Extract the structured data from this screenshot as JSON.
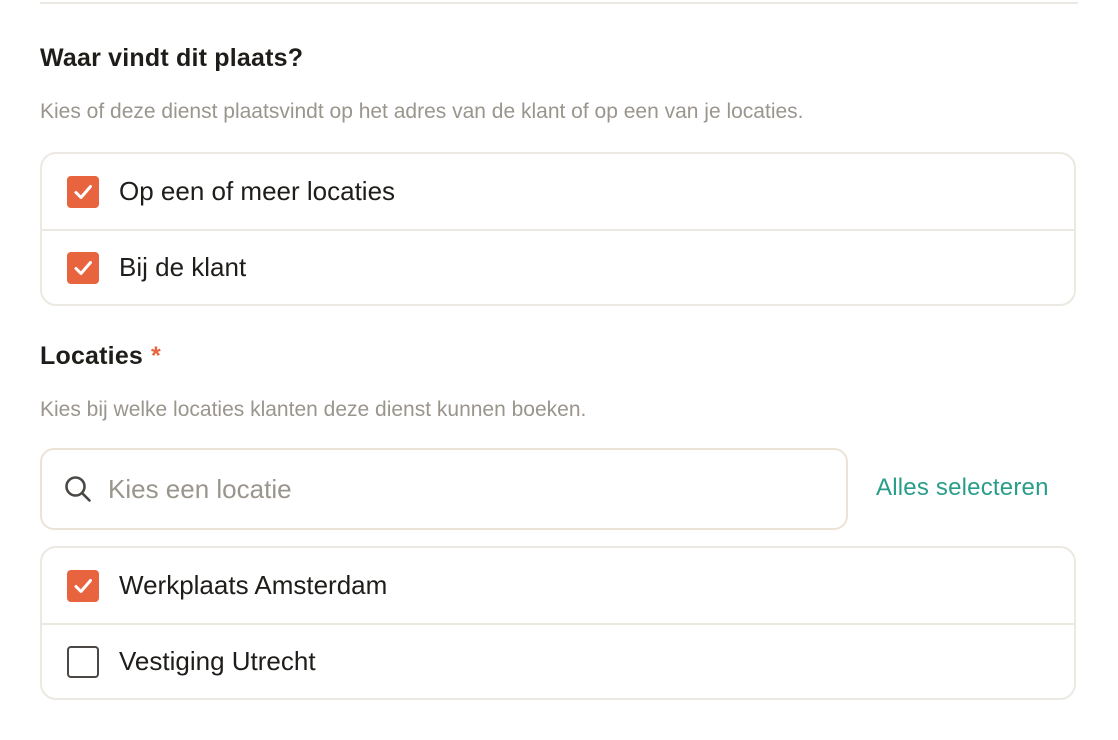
{
  "where": {
    "title": "Waar vindt dit plaats?",
    "description": "Kies of deze dienst plaatsvindt op het adres van de klant of op een van je locaties.",
    "options": [
      {
        "label": "Op een of meer locaties",
        "checked": true
      },
      {
        "label": "Bij de klant",
        "checked": true
      }
    ]
  },
  "locations": {
    "title": "Locaties",
    "required_marker": "*",
    "description": "Kies bij welke locaties klanten deze dienst kunnen boeken.",
    "search": {
      "value": "",
      "placeholder": "Kies een locatie",
      "icon": "search-icon"
    },
    "select_all_label": "Alles selecteren",
    "items": [
      {
        "label": "Werkplaats Amsterdam",
        "checked": true
      },
      {
        "label": "Vestiging Utrecht",
        "checked": false
      }
    ]
  },
  "colors": {
    "accent": "#e8643f",
    "link": "#2a9d8a",
    "border": "#ece9e3",
    "muted_text": "#9a958d"
  }
}
